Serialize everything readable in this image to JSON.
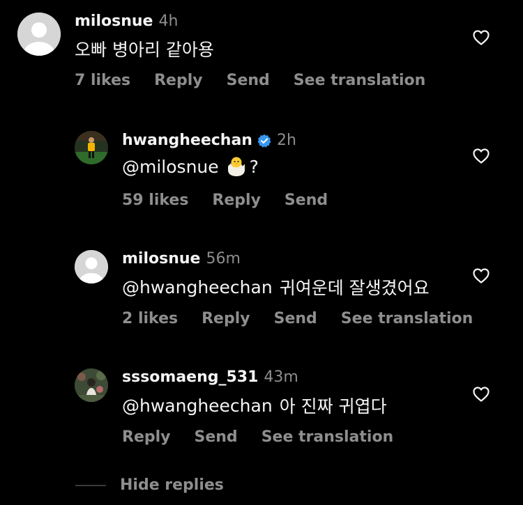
{
  "comments": [
    {
      "username": "milosnue",
      "time": "4h",
      "verified": false,
      "text": "오빠 병아리 같아용",
      "likes": "7 likes",
      "reply": "Reply",
      "send": "Send",
      "translation": "See translation"
    },
    {
      "username": "hwangheechan",
      "time": "2h",
      "verified": true,
      "mention": "@milosnue",
      "emoji": "🐣",
      "suffix": "?",
      "likes": "59 likes",
      "reply": "Reply",
      "send": "Send"
    },
    {
      "username": "milosnue",
      "time": "56m",
      "verified": false,
      "mention": "@hwangheechan",
      "text": "귀여운데 잘생겼어요",
      "likes": "2 likes",
      "reply": "Reply",
      "send": "Send",
      "translation": "See translation"
    },
    {
      "username": "sssomaeng_531",
      "time": "43m",
      "verified": false,
      "mention": "@hwangheechan",
      "text": "아 진짜 귀엽다",
      "reply": "Reply",
      "send": "Send",
      "translation": "See translation"
    }
  ],
  "hide_replies": "Hide replies",
  "colors": {
    "background": "#000000",
    "text_primary": "#f5f5f5",
    "text_secondary": "#8e8e8e",
    "verified_badge": "#3897f0"
  }
}
